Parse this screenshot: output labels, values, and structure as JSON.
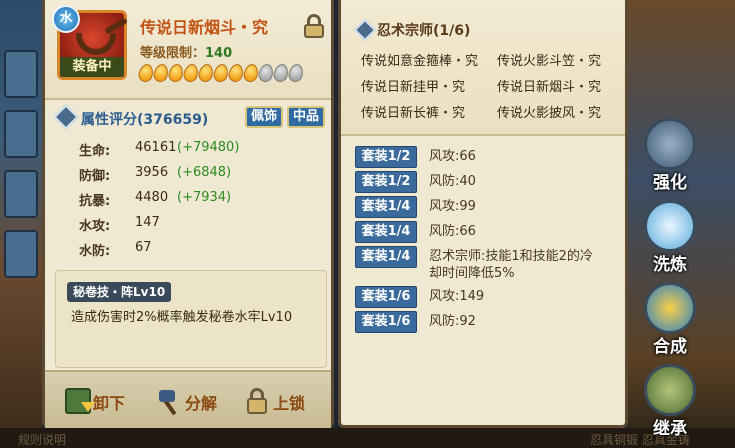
{
  "item": {
    "name": "传说日新烟斗・究",
    "element_badge": "水",
    "equipped_label": "装备中",
    "level_requirement_label": "等级限制：",
    "level_requirement_value": "140",
    "stars_total": 11,
    "stars_filled": 8
  },
  "rating": {
    "label": "属性评分(376659)",
    "tags": [
      "佩饰",
      "中品"
    ]
  },
  "stats": [
    {
      "label": "生命:",
      "value": "46161",
      "bonus": "(+79480)"
    },
    {
      "label": "防御:",
      "value": "3956",
      "bonus": "(+6848)"
    },
    {
      "label": "抗暴:",
      "value": "4480",
      "bonus": "(+7934)"
    },
    {
      "label": "水攻:",
      "value": "147",
      "bonus": ""
    },
    {
      "label": "水防:",
      "value": "67",
      "bonus": ""
    }
  ],
  "skill": {
    "title": "秘卷技・阵Lv10",
    "description": "造成伤害时2%概率触发秘卷水牢Lv10"
  },
  "actions": {
    "unequip": "卸下",
    "decompose": "分解",
    "lock": "上锁"
  },
  "set": {
    "title": "忍术宗师(1/6)",
    "items": [
      "传说如意金箍棒・究",
      "传说火影斗笠・究",
      "传说日新挂甲・究",
      "传说日新烟斗・究",
      "传说日新长裤・究",
      "传说火影披风・究"
    ],
    "bonuses": [
      {
        "badge": "套装1/2",
        "text": "风攻:66"
      },
      {
        "badge": "套装1/2",
        "text": "风防:40"
      },
      {
        "badge": "套装1/4",
        "text": "风攻:99"
      },
      {
        "badge": "套装1/4",
        "text": "风防:66"
      },
      {
        "badge": "套装1/4",
        "text": "忍术宗师:技能1和技能2的冷却时间降低5%"
      },
      {
        "badge": "套装1/6",
        "text": "风攻:149"
      },
      {
        "badge": "套装1/6",
        "text": "风防:92"
      }
    ]
  },
  "side_buttons": {
    "strengthen": "强化",
    "refine": "洗炼",
    "synthesize": "合成",
    "inherit": "继承"
  },
  "background": {
    "bottom_left": "规则说明",
    "bottom_right": "忍具铜锻  忍具金铸"
  }
}
